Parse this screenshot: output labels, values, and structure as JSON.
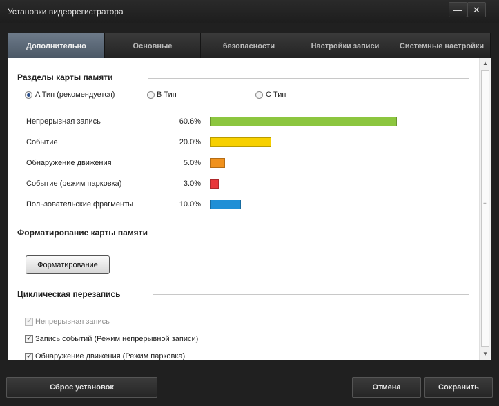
{
  "window": {
    "title": "Установки видеорегистратора",
    "minimize_glyph": "—",
    "close_glyph": "✕"
  },
  "tabs": [
    {
      "label": "Дополнительно",
      "active": true
    },
    {
      "label": "Основные",
      "active": false
    },
    {
      "label": "безопасности",
      "active": false
    },
    {
      "label": "Настройки записи",
      "active": false
    },
    {
      "label": "Системные настройки",
      "active": false
    }
  ],
  "memory_partitions": {
    "title": "Разделы карты памяти",
    "types": [
      {
        "label": "A Тип (рекомендуется)",
        "selected": true
      },
      {
        "label": "B Тип",
        "selected": false
      },
      {
        "label": "C Тип",
        "selected": false
      }
    ],
    "rows": [
      {
        "label": "Непрерывная запись",
        "percent_text": "60.6%",
        "value": 60.6,
        "color": "#8cc63f"
      },
      {
        "label": "Событие",
        "percent_text": "20.0%",
        "value": 20.0,
        "color": "#f7d000"
      },
      {
        "label": "Обнаружение движения",
        "percent_text": "5.0%",
        "value": 5.0,
        "color": "#f0911c"
      },
      {
        "label": "Событие (режим парковка)",
        "percent_text": "3.0%",
        "value": 3.0,
        "color": "#e8373b"
      },
      {
        "label": "Пользовательские фрагменты",
        "percent_text": "10.0%",
        "value": 10.0,
        "color": "#1f8fd6"
      }
    ]
  },
  "formatting": {
    "title": "Форматирование карты памяти",
    "button_label": "Форматирование"
  },
  "cyclic": {
    "title": "Циклическая перезапись",
    "options": [
      {
        "label": "Непрерывная запись",
        "checked": true,
        "disabled": true
      },
      {
        "label": "Запись событий (Режим непрерывной записи)",
        "checked": true,
        "disabled": false
      },
      {
        "label": "Обнаружение движения (Режим парковка)",
        "checked": true,
        "disabled": false
      }
    ]
  },
  "footer": {
    "reset_label": "Сброс установок",
    "cancel_label": "Отмена",
    "save_label": "Сохранить"
  }
}
